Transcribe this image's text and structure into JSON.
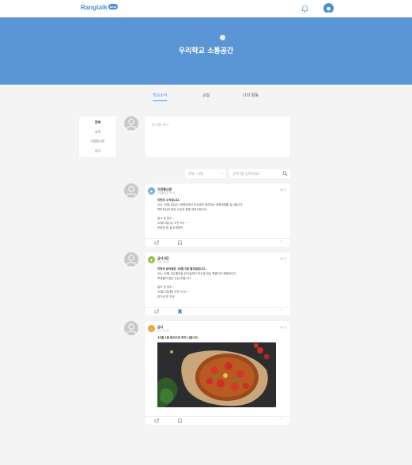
{
  "header": {
    "logo": "Rangtalk",
    "logo_badge": "beta",
    "bell_icon": "bell-icon",
    "user_icon": "user-icon"
  },
  "hero": {
    "title": "우리학교 소통공간"
  },
  "tabs": [
    {
      "label": "학교소식",
      "active": true
    },
    {
      "label": "교실",
      "active": false
    },
    {
      "label": "나의 활동",
      "active": false
    }
  ],
  "sidebar": {
    "items": [
      {
        "label": "전체",
        "active": true
      },
      {
        "label": "교직",
        "active": false
      },
      {
        "label": "가정통신문",
        "active": false
      },
      {
        "label": "급식",
        "active": false
      }
    ]
  },
  "compose": {
    "placeholder": "글 내용 표시"
  },
  "filter": {
    "selected": "전체 - 나열",
    "chevron": "⌄"
  },
  "search": {
    "placeholder": "검색어를 입력하세요"
  },
  "posts": [
    {
      "badge_color": "#6fa8dc",
      "author": "가정통신문",
      "subtitle": "가정통신문 게시판",
      "time": "1일 전",
      "headline": "이번주 소식입니다.",
      "lines": [
        "오는 10월 4일(수) 체육관에서 전교생이 참여하는 체육대회를 실시합니다.",
        "학부모님의 많은 관심과 응원 부탁드립니다.",
        "",
        "일시 및 장소 :",
        "10월 4일(수) 오전 9시 ~",
        "운동장 및 실내 체육관"
      ],
      "saved": false
    },
    {
      "badge_color": "#8bc34a",
      "author": "급식식단",
      "subtitle": "급식 게시판",
      "time": "1일 전",
      "headline": "이번주 급식일은 10월 2일 월요일입니다.",
      "lines": [
        "오는 10월 2일 월요일 급식실에서 전교생 대상 특별식이 제공됩니다.",
        "학생들의 많은 관심 바랍니다.",
        "",
        "일자 및 장소 :",
        "10월 2일(월) 오전 11시 ~",
        "급식실 및 교실"
      ],
      "saved": true
    },
    {
      "badge_color": "#f0a040",
      "author": "급식",
      "subtitle": "급식 게시판",
      "time": "1일 전",
      "headline": "12월 1일 특식으로 피자 나옵니다.",
      "lines": [],
      "saved": false
    }
  ],
  "footer_icons": {
    "share": "share-icon",
    "save": "bookmark-icon",
    "more": "···"
  },
  "colors": {
    "accent": "#4a8fd6",
    "hero": "#5a96d6"
  }
}
